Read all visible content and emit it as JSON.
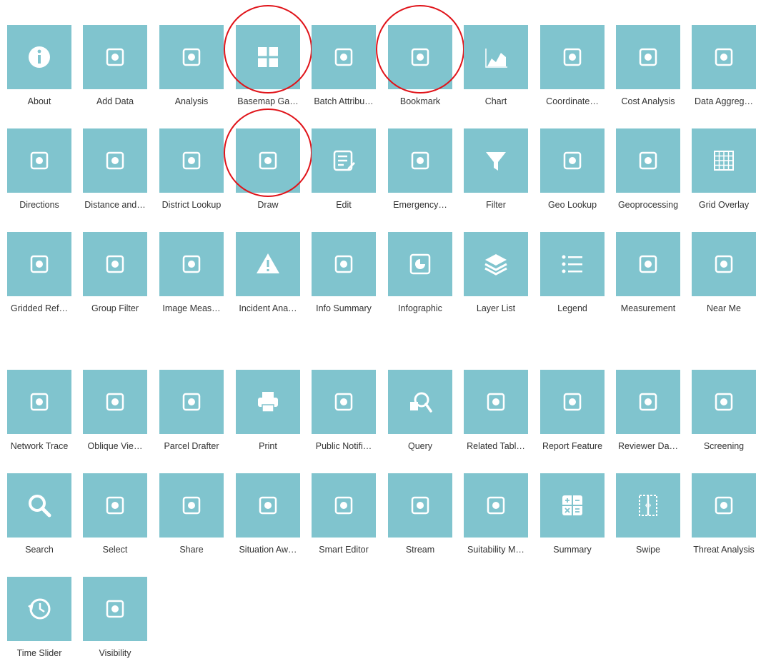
{
  "colors": {
    "tile": "#80c4ce",
    "glyph": "#ffffff",
    "label": "#333333",
    "highlight": "#e0141a"
  },
  "widgets": [
    {
      "label": "About",
      "icon": "info-icon",
      "highlighted": false
    },
    {
      "label": "Add Data",
      "icon": "add-data-icon",
      "highlighted": false
    },
    {
      "label": "Analysis",
      "icon": "analysis-icon",
      "highlighted": false
    },
    {
      "label": "Basemap Ga…",
      "icon": "basemap-gallery-icon",
      "highlighted": true
    },
    {
      "label": "Batch Attribu…",
      "icon": "batch-attribute-icon",
      "highlighted": false
    },
    {
      "label": "Bookmark",
      "icon": "bookmark-icon",
      "highlighted": true
    },
    {
      "label": "Chart",
      "icon": "chart-icon",
      "highlighted": false
    },
    {
      "label": "Coordinate…",
      "icon": "coordinate-icon",
      "highlighted": false
    },
    {
      "label": "Cost Analysis",
      "icon": "cost-analysis-icon",
      "highlighted": false
    },
    {
      "label": "Data Aggreg…",
      "icon": "data-aggregation-icon",
      "highlighted": false
    },
    {
      "label": "Directions",
      "icon": "directions-icon",
      "highlighted": false
    },
    {
      "label": "Distance and…",
      "icon": "distance-direction-icon",
      "highlighted": false
    },
    {
      "label": "District Lookup",
      "icon": "district-lookup-icon",
      "highlighted": false
    },
    {
      "label": "Draw",
      "icon": "draw-palette-icon",
      "highlighted": true
    },
    {
      "label": "Edit",
      "icon": "edit-icon",
      "highlighted": false
    },
    {
      "label": "Emergency…",
      "icon": "emergency-icon",
      "highlighted": false
    },
    {
      "label": "Filter",
      "icon": "filter-icon",
      "highlighted": false
    },
    {
      "label": "Geo Lookup",
      "icon": "geo-lookup-icon",
      "highlighted": false
    },
    {
      "label": "Geoprocessing",
      "icon": "geoprocessing-icon",
      "highlighted": false
    },
    {
      "label": "Grid Overlay",
      "icon": "grid-overlay-icon",
      "highlighted": false
    },
    {
      "label": "Gridded Ref…",
      "icon": "gridded-reference-icon",
      "highlighted": false
    },
    {
      "label": "Group Filter",
      "icon": "group-filter-icon",
      "highlighted": false
    },
    {
      "label": "Image Meas…",
      "icon": "image-measurement-icon",
      "highlighted": false
    },
    {
      "label": "Incident Ana…",
      "icon": "incident-analysis-icon",
      "highlighted": false
    },
    {
      "label": "Info Summary",
      "icon": "info-summary-icon",
      "highlighted": false
    },
    {
      "label": "Infographic",
      "icon": "infographic-icon",
      "highlighted": false
    },
    {
      "label": "Layer List",
      "icon": "layer-list-icon",
      "highlighted": false
    },
    {
      "label": "Legend",
      "icon": "legend-icon",
      "highlighted": false
    },
    {
      "label": "Measurement",
      "icon": "measurement-icon",
      "highlighted": false
    },
    {
      "label": "Near Me",
      "icon": "near-me-icon",
      "highlighted": false
    },
    {
      "label": "Network Trace",
      "icon": "network-trace-icon",
      "highlighted": false
    },
    {
      "label": "Oblique Vie…",
      "icon": "oblique-viewer-icon",
      "highlighted": false
    },
    {
      "label": "Parcel Drafter",
      "icon": "parcel-drafter-icon",
      "highlighted": false
    },
    {
      "label": "Print",
      "icon": "print-icon",
      "highlighted": false
    },
    {
      "label": "Public Notifi…",
      "icon": "public-notification-icon",
      "highlighted": false
    },
    {
      "label": "Query",
      "icon": "query-icon",
      "highlighted": false
    },
    {
      "label": "Related Tabl…",
      "icon": "related-table-icon",
      "highlighted": false
    },
    {
      "label": "Report Feature",
      "icon": "report-feature-icon",
      "highlighted": false
    },
    {
      "label": "Reviewer Da…",
      "icon": "reviewer-dashboard-icon",
      "highlighted": false
    },
    {
      "label": "Screening",
      "icon": "screening-icon",
      "highlighted": false
    },
    {
      "label": "Search",
      "icon": "search-icon",
      "highlighted": false
    },
    {
      "label": "Select",
      "icon": "select-icon",
      "highlighted": false
    },
    {
      "label": "Share",
      "icon": "share-icon",
      "highlighted": false
    },
    {
      "label": "Situation Aw…",
      "icon": "situation-awareness-icon",
      "highlighted": false
    },
    {
      "label": "Smart Editor",
      "icon": "smart-editor-icon",
      "highlighted": false
    },
    {
      "label": "Stream",
      "icon": "stream-icon",
      "highlighted": false
    },
    {
      "label": "Suitability M…",
      "icon": "suitability-modeler-icon",
      "highlighted": false
    },
    {
      "label": "Summary",
      "icon": "summary-calculator-icon",
      "highlighted": false
    },
    {
      "label": "Swipe",
      "icon": "swipe-icon",
      "highlighted": false
    },
    {
      "label": "Threat Analysis",
      "icon": "threat-analysis-icon",
      "highlighted": false
    },
    {
      "label": "Time Slider",
      "icon": "time-slider-icon",
      "highlighted": false
    },
    {
      "label": "Visibility",
      "icon": "visibility-icon",
      "highlighted": false
    }
  ]
}
